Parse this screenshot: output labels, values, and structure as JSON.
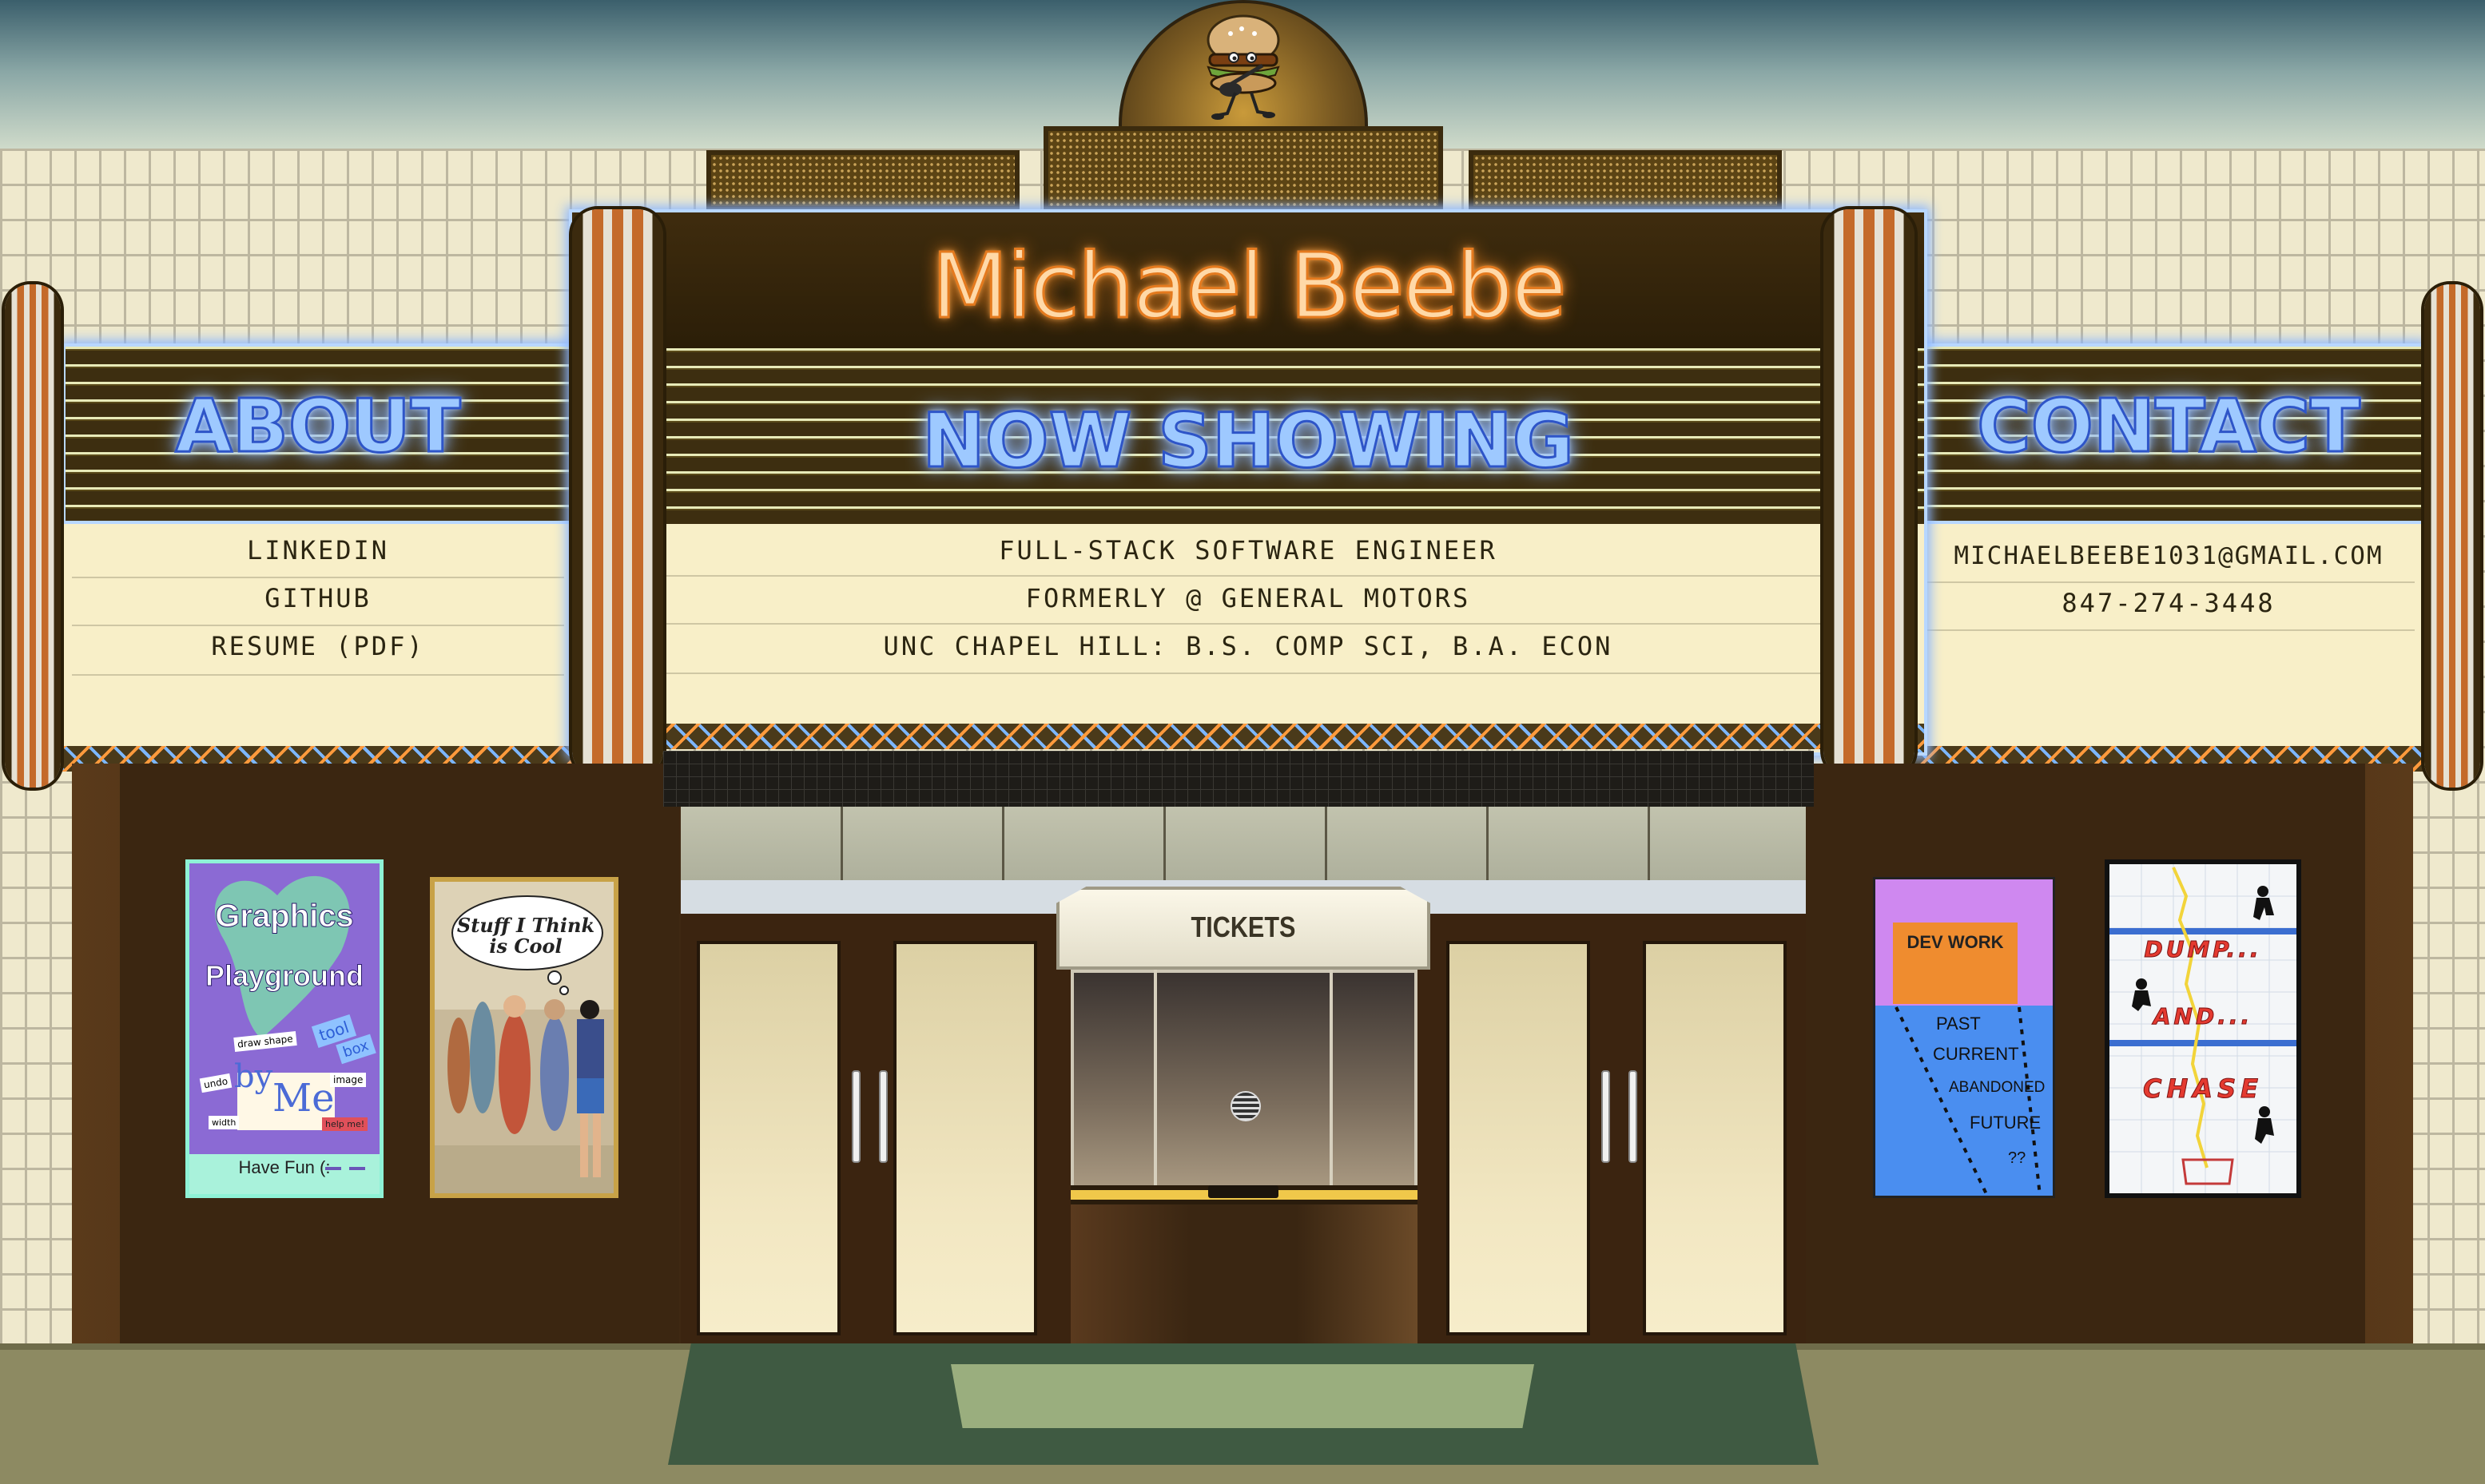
{
  "marquee": {
    "title": "Michael Beebe",
    "center_heading": "NOW SHOWING",
    "center_lines": [
      "FULL-STACK SOFTWARE ENGINEER",
      "FORMERLY @ GENERAL MOTORS",
      "UNC CHAPEL HILL: B.S. COMP SCI, B.A. ECON"
    ]
  },
  "about": {
    "heading": "ABOUT",
    "links": [
      "LINKEDIN",
      "GITHUB",
      "RESUME (PDF)"
    ]
  },
  "contact": {
    "heading": "CONTACT",
    "email": "MICHAELBEEBE1031@GMAIL.COM",
    "phone": "847-274-3448"
  },
  "booth": {
    "label": "TICKETS"
  },
  "posters": {
    "graphics": {
      "title_1": "Graphics",
      "title_2": "Playground",
      "by": "by",
      "me": "Me",
      "tags": [
        "draw shape",
        "tool",
        "box",
        "undo",
        "image",
        "width",
        "help me!"
      ],
      "footer": "Have Fun (:"
    },
    "stuff": {
      "title": "Stuff I Think is Cool"
    },
    "dev": {
      "title": "DEV WORK",
      "items": [
        "PAST",
        "CURRENT",
        "ABANDONED",
        "FUTURE",
        "??"
      ]
    },
    "dump": {
      "words": [
        "DUMP...",
        "AND...",
        "CHASE"
      ]
    }
  },
  "colors": {
    "neon_blue": "#9ec9ff",
    "neon_orange": "#ffd9a8",
    "brick": "#efe9cd",
    "wood": "#3f2812"
  }
}
